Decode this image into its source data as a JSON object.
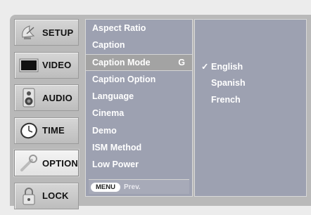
{
  "categories": [
    {
      "label": "SETUP",
      "icon": "satellite-dish-icon"
    },
    {
      "label": "VIDEO",
      "icon": "monitor-icon"
    },
    {
      "label": "AUDIO",
      "icon": "speaker-icon"
    },
    {
      "label": "TIME",
      "icon": "clock-icon"
    },
    {
      "label": "OPTION",
      "icon": "option-tool-icon",
      "active": true
    },
    {
      "label": "LOCK",
      "icon": "padlock-icon"
    }
  ],
  "menu": {
    "items": [
      {
        "label": "Aspect Ratio"
      },
      {
        "label": "Caption"
      },
      {
        "label": "Caption Mode",
        "selected": true,
        "hint": "G"
      },
      {
        "label": "Caption Option"
      },
      {
        "label": "Language"
      },
      {
        "label": "Cinema"
      },
      {
        "label": "Demo"
      },
      {
        "label": "ISM Method"
      },
      {
        "label": "Low Power"
      }
    ],
    "footer": {
      "button": "MENU",
      "text": "Prev."
    }
  },
  "options": {
    "items": [
      {
        "label": "English",
        "checked": true,
        "check_mark": "✓"
      },
      {
        "label": "Spanish",
        "checked": false,
        "check_mark": ""
      },
      {
        "label": "French",
        "checked": false,
        "check_mark": ""
      }
    ]
  },
  "colors": {
    "panel": "#9da1b1",
    "frame": "#b9b9b9",
    "highlight": "#a3a3a3"
  }
}
